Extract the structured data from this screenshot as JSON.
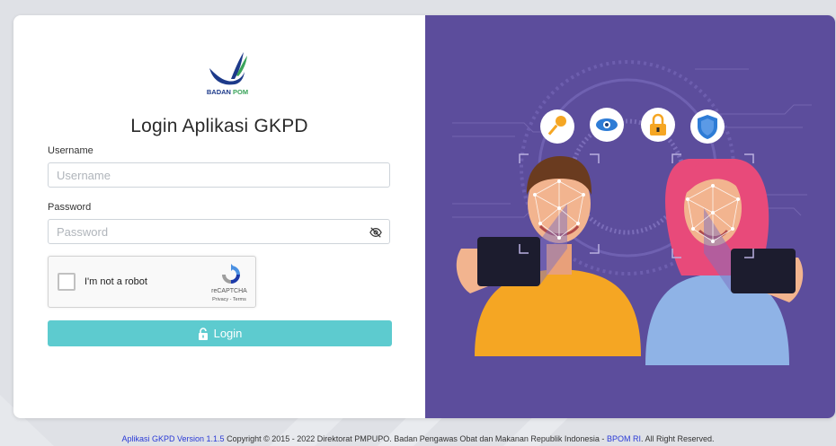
{
  "brand": {
    "logo_text": "BADAN POM"
  },
  "login": {
    "title": "Login Aplikasi GKPD",
    "username_label": "Username",
    "username_placeholder": "Username",
    "password_label": "Password",
    "password_placeholder": "Password",
    "button_label": "Login",
    "button_icon": "unlock-icon"
  },
  "captcha": {
    "label": "I'm not a robot",
    "brand": "reCAPTCHA",
    "links": "Privacy - Terms"
  },
  "footer": {
    "version_link": "Aplikasi GKPD Version 1.1.5",
    "copyright": " Copyright © 2015 - 2022 Direktorat PMPUPO. Badan Pengawas Obat dan Makanan Republik Indonesia - ",
    "bpom_link": "BPOM RI",
    "rights": ". All Right Reserved."
  },
  "colors": {
    "accent_button": "#5dcbcf",
    "illustration_bg": "#5c4d9c",
    "link": "#2a3ad6"
  }
}
